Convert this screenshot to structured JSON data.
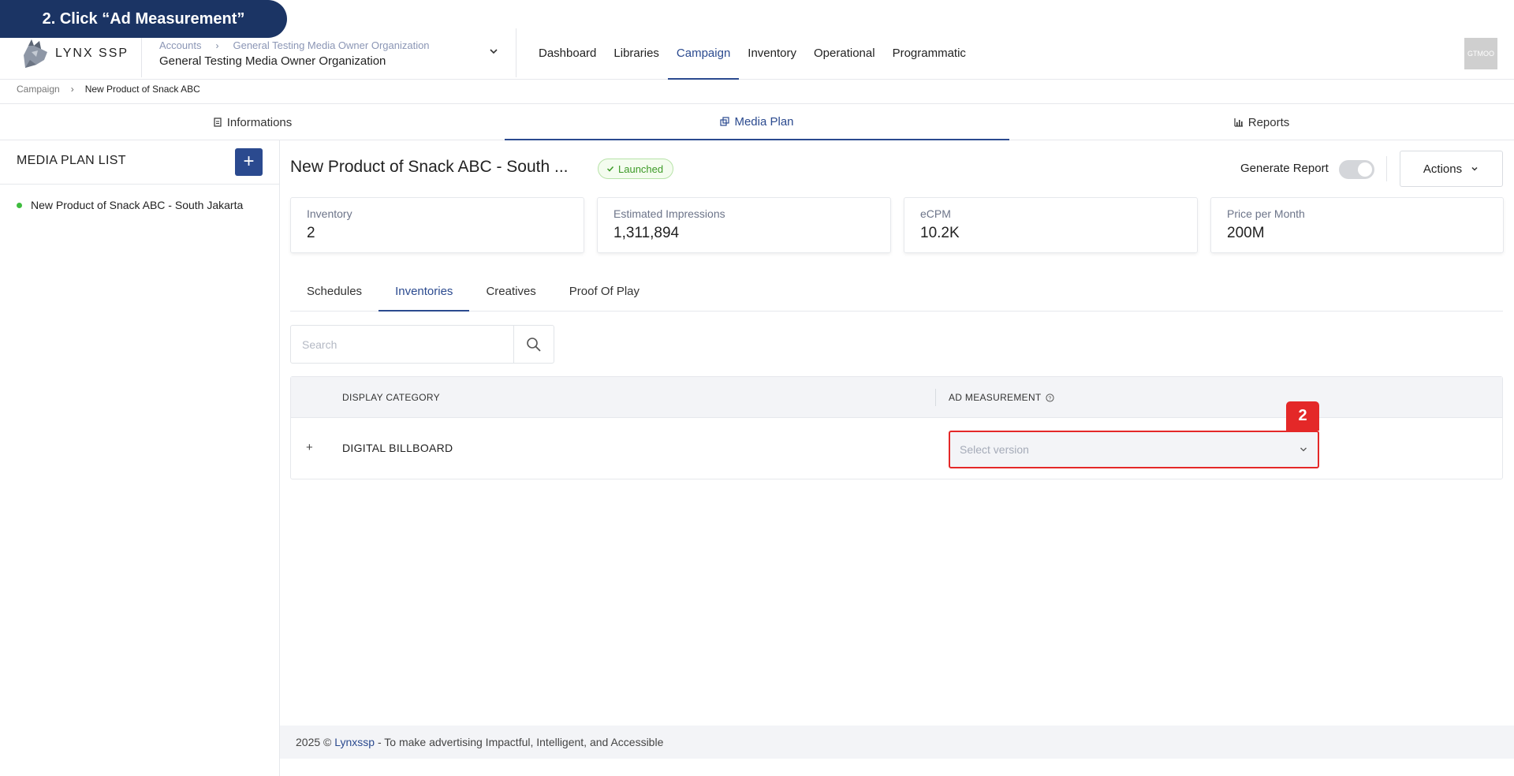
{
  "callout": "2. Click “Ad Measurement”",
  "header": {
    "logo_text": "LYNX SSP",
    "crumbs": [
      "Accounts",
      "General Testing Media Owner Organization"
    ],
    "org_name": "General Testing Media Owner Organization",
    "nav": [
      {
        "label": "Dashboard",
        "active": false
      },
      {
        "label": "Libraries",
        "active": false
      },
      {
        "label": "Campaign",
        "active": true
      },
      {
        "label": "Inventory",
        "active": false
      },
      {
        "label": "Operational",
        "active": false
      },
      {
        "label": "Programmatic",
        "active": false
      }
    ],
    "avatar_text": "GTMOO"
  },
  "breadcrumb": [
    "Campaign",
    "New Product of Snack ABC"
  ],
  "top_tabs": [
    {
      "label": "Informations",
      "icon": "document-icon",
      "active": false
    },
    {
      "label": "Media Plan",
      "icon": "copy-icon",
      "active": true
    },
    {
      "label": "Reports",
      "icon": "bar-chart-icon",
      "active": false
    }
  ],
  "sidebar": {
    "title": "MEDIA PLAN LIST",
    "add_label": "+",
    "items": [
      {
        "label": "New Product of Snack ABC - South Jakarta",
        "status_color": "#3ebc3e"
      }
    ]
  },
  "plan": {
    "title": "New Product of Snack ABC - South ...",
    "status": "Launched",
    "generate_report_label": "Generate Report",
    "generate_report_on": false,
    "actions_label": "Actions"
  },
  "stats": [
    {
      "label": "Inventory",
      "value": "2"
    },
    {
      "label": "Estimated Impressions",
      "value": "1,311,894"
    },
    {
      "label": "eCPM",
      "value": "10.2K"
    },
    {
      "label": "Price per Month",
      "value": "200M"
    }
  ],
  "sub_tabs": [
    {
      "label": "Schedules",
      "active": false
    },
    {
      "label": "Inventories",
      "active": true
    },
    {
      "label": "Creatives",
      "active": false
    },
    {
      "label": "Proof Of Play",
      "active": false
    }
  ],
  "search": {
    "placeholder": "Search",
    "value": ""
  },
  "table": {
    "columns": [
      "DISPLAY CATEGORY",
      "AD MEASUREMENT"
    ],
    "rows": [
      {
        "expand": "+",
        "category": "DIGITAL BILLBOARD",
        "select_placeholder": "Select version"
      }
    ]
  },
  "step_badge": "2",
  "footer": {
    "prefix": "2025 © ",
    "brand": "Lynxssp",
    "suffix": " - To make advertising Impactful, Intelligent, and Accessible"
  },
  "colors": {
    "accent": "#2b4a8f",
    "callout_bg": "#1b3464",
    "highlight": "#e42828",
    "success": "#3c9a27"
  }
}
